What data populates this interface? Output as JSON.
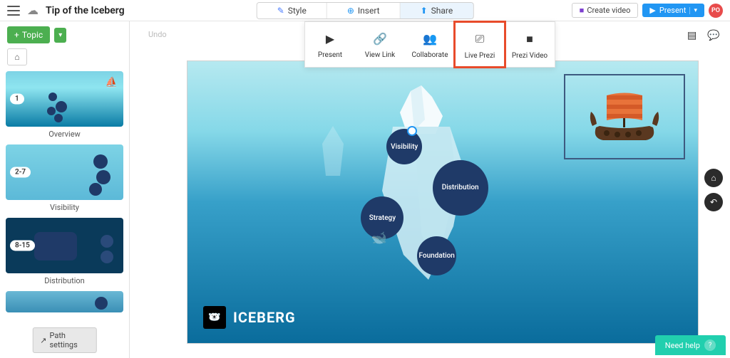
{
  "header": {
    "title": "Tip of the Iceberg",
    "tabs": {
      "style": "Style",
      "insert": "Insert",
      "share": "Share"
    },
    "create_video": "Create video",
    "present": "Present",
    "avatar": "PO"
  },
  "sidebar": {
    "topic_btn": "Topic",
    "thumbs": [
      {
        "badge": "1",
        "label": "Overview"
      },
      {
        "badge": "2-7",
        "label": "Visibility"
      },
      {
        "badge": "8-15",
        "label": "Distribution"
      },
      {
        "badge": "",
        "label": ""
      }
    ],
    "path_settings": "Path settings"
  },
  "canvas": {
    "undo": "Undo",
    "bubbles": {
      "visibility": "Visibility",
      "distribution": "Distribution",
      "strategy": "Strategy",
      "foundation": "Foundation"
    },
    "logo_text": "ICEBERG"
  },
  "share_panel": {
    "present": "Present",
    "view_link": "View Link",
    "collaborate": "Collaborate",
    "live_prezi": "Live Prezi",
    "prezi_video": "Prezi Video"
  },
  "need_help": "Need help"
}
